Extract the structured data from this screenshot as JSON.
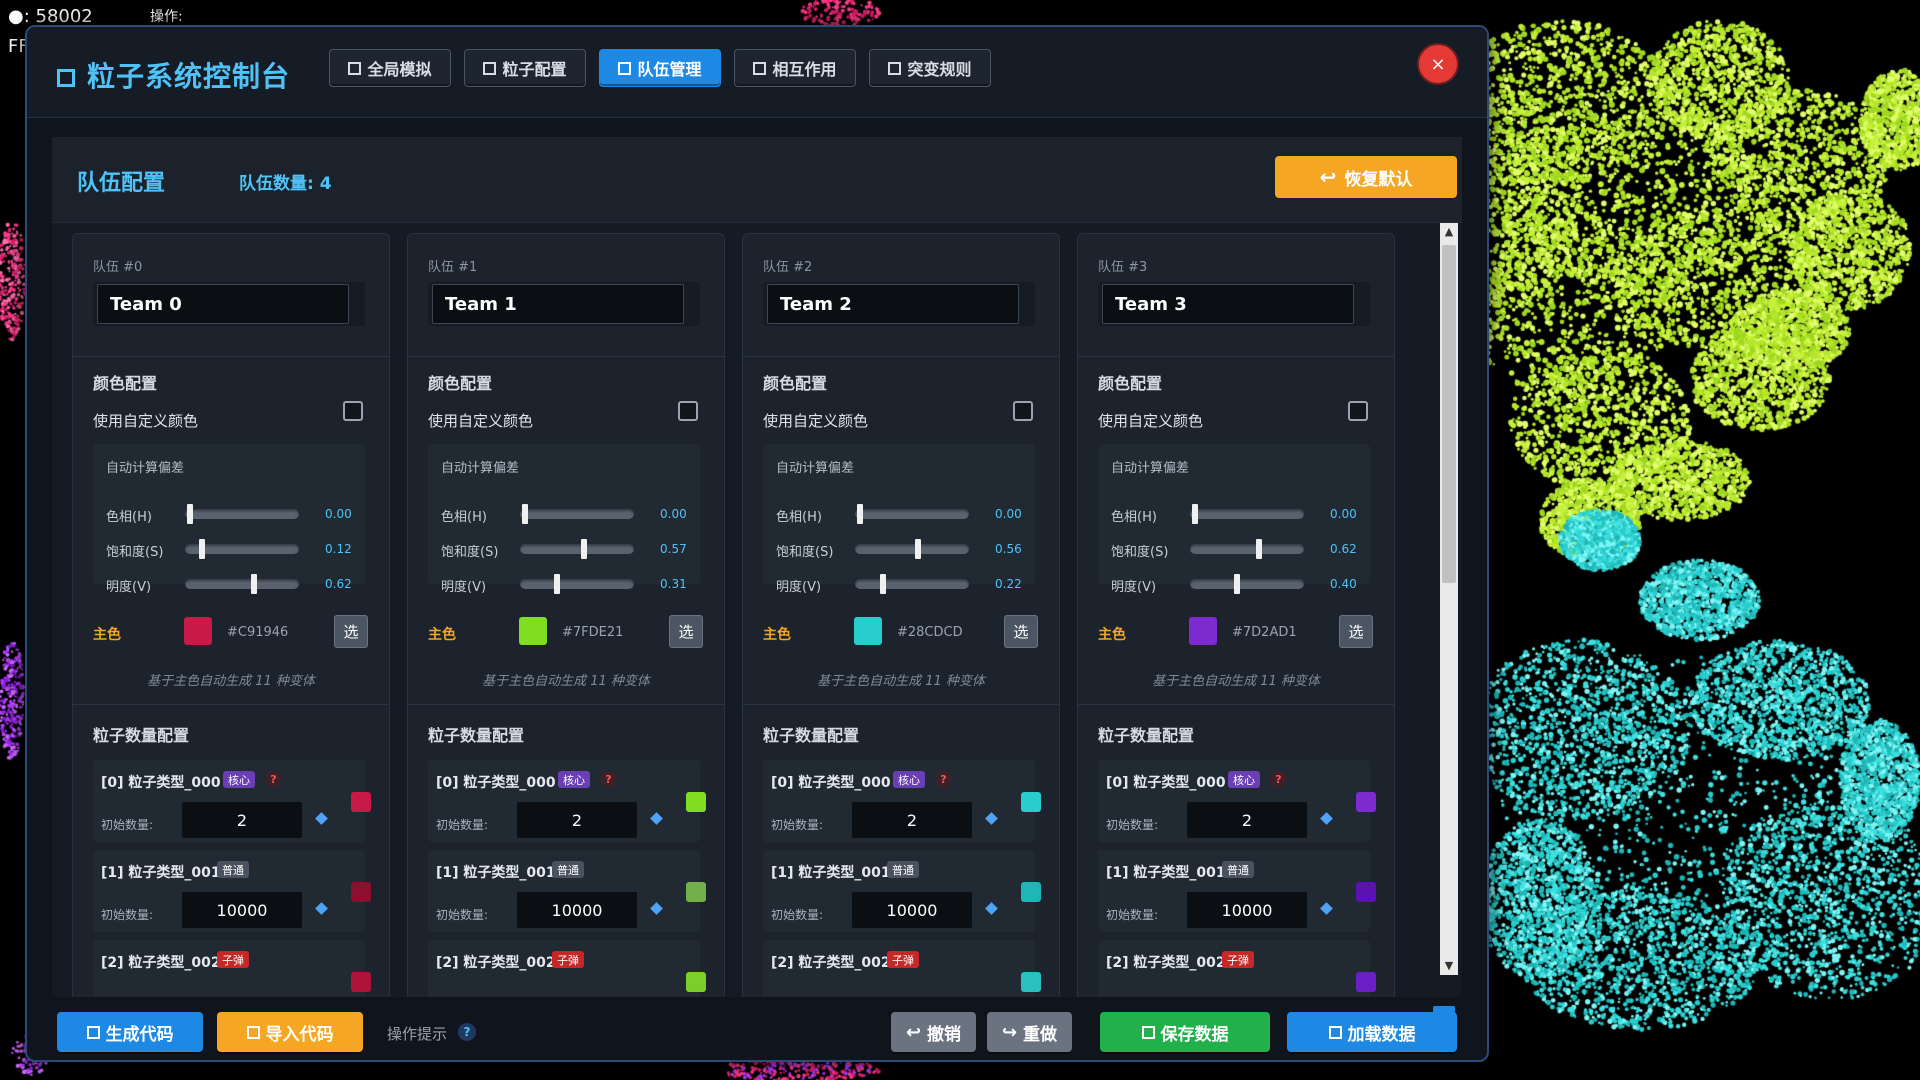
{
  "hud": {
    "line1": "●: 58002",
    "line2": "FF",
    "ops": "操作:"
  },
  "panel": {
    "title": "粒子系统控制台",
    "tabs": [
      {
        "label": "全局模拟",
        "active": false
      },
      {
        "label": "粒子配置",
        "active": false
      },
      {
        "label": "队伍管理",
        "active": true
      },
      {
        "label": "相互作用",
        "active": false
      },
      {
        "label": "突变规则",
        "active": false
      }
    ],
    "close_glyph": "×"
  },
  "section": {
    "title": "队伍配置",
    "team_count": "队伍数量: 4",
    "restore_label": "恢复默认",
    "restore_icon": "↩"
  },
  "labels": {
    "color_config": "颜色配置",
    "use_custom_color": "使用自定义颜色",
    "auto_offset": "自动计算偏差",
    "hue": "色相(H)",
    "saturation": "饱和度(S)",
    "brightness": "明度(V)",
    "main_color": "主色",
    "pick": "选",
    "variant_hint": "基于主色自动生成 11 种变体",
    "count_config": "粒子数量配置",
    "init_count": "初始数量:"
  },
  "teams": [
    {
      "label": "队伍 #0",
      "name": "Team 0",
      "h": "0.00",
      "s": "0.12",
      "v": "0.62",
      "h_val": 0.0,
      "s_val": 0.12,
      "v_val": 0.62,
      "main_hex": "#C91946",
      "main_color": "#c91946",
      "types": [
        {
          "name": "[0] 粒子类型_000",
          "badge": "核心",
          "kind": "core",
          "help": "?",
          "count": "2",
          "swatch": "#c91946"
        },
        {
          "name": "[1] 粒子类型_001",
          "badge": "普通",
          "kind": "normal",
          "count": "10000",
          "swatch": "#8c0f2e"
        },
        {
          "name": "[2] 粒子类型_002",
          "badge": "子弹",
          "kind": "bullet",
          "swatch": "#b0133a"
        }
      ]
    },
    {
      "label": "队伍 #1",
      "name": "Team 1",
      "h": "0.00",
      "s": "0.57",
      "v": "0.31",
      "h_val": 0.0,
      "s_val": 0.57,
      "v_val": 0.31,
      "main_hex": "#7FDE21",
      "main_color": "#7fde21",
      "types": [
        {
          "name": "[0] 粒子类型_000",
          "badge": "核心",
          "kind": "core",
          "help": "?",
          "count": "2",
          "swatch": "#7fde21"
        },
        {
          "name": "[1] 粒子类型_001",
          "badge": "普通",
          "kind": "normal",
          "count": "10000",
          "swatch": "#74b04a"
        },
        {
          "name": "[2] 粒子类型_002",
          "badge": "子弹",
          "kind": "bullet",
          "swatch": "#7ccf2a"
        }
      ]
    },
    {
      "label": "队伍 #2",
      "name": "Team 2",
      "h": "0.00",
      "s": "0.56",
      "v": "0.22",
      "h_val": 0.0,
      "s_val": 0.56,
      "v_val": 0.22,
      "main_hex": "#28CDCD",
      "main_color": "#28cdcd",
      "types": [
        {
          "name": "[0] 粒子类型_000",
          "badge": "核心",
          "kind": "core",
          "help": "?",
          "count": "2",
          "swatch": "#28cdcd"
        },
        {
          "name": "[1] 粒子类型_001",
          "badge": "普通",
          "kind": "normal",
          "count": "10000",
          "swatch": "#1fb6b6"
        },
        {
          "name": "[2] 粒子类型_002",
          "badge": "子弹",
          "kind": "bullet",
          "swatch": "#2ac0c0"
        }
      ]
    },
    {
      "label": "队伍 #3",
      "name": "Team 3",
      "h": "0.00",
      "s": "0.62",
      "v": "0.40",
      "h_val": 0.0,
      "s_val": 0.62,
      "v_val": 0.4,
      "main_hex": "#7D2AD1",
      "main_color": "#7d2ad1",
      "types": [
        {
          "name": "[0] 粒子类型_000",
          "badge": "核心",
          "kind": "core",
          "help": "?",
          "count": "2",
          "swatch": "#7d2ad1"
        },
        {
          "name": "[1] 粒子类型_001",
          "badge": "普通",
          "kind": "normal",
          "count": "10000",
          "swatch": "#5a12b5"
        },
        {
          "name": "[2] 粒子类型_002",
          "badge": "子弹",
          "kind": "bullet",
          "swatch": "#6a1fc6"
        }
      ]
    }
  ],
  "footer": {
    "generate": "生成代码",
    "import": "导入代码",
    "ops_hint": "操作提示",
    "ops_q": "?",
    "undo": "撤销",
    "undo_icon": "↩",
    "redo": "重做",
    "redo_icon": "↪",
    "save": "保存数据",
    "load": "加载数据"
  },
  "colors": {
    "accent": "#1e88e5",
    "title": "#4fc3f7",
    "orange": "#f5a623",
    "green": "#22b04b",
    "close": "#e53935"
  }
}
